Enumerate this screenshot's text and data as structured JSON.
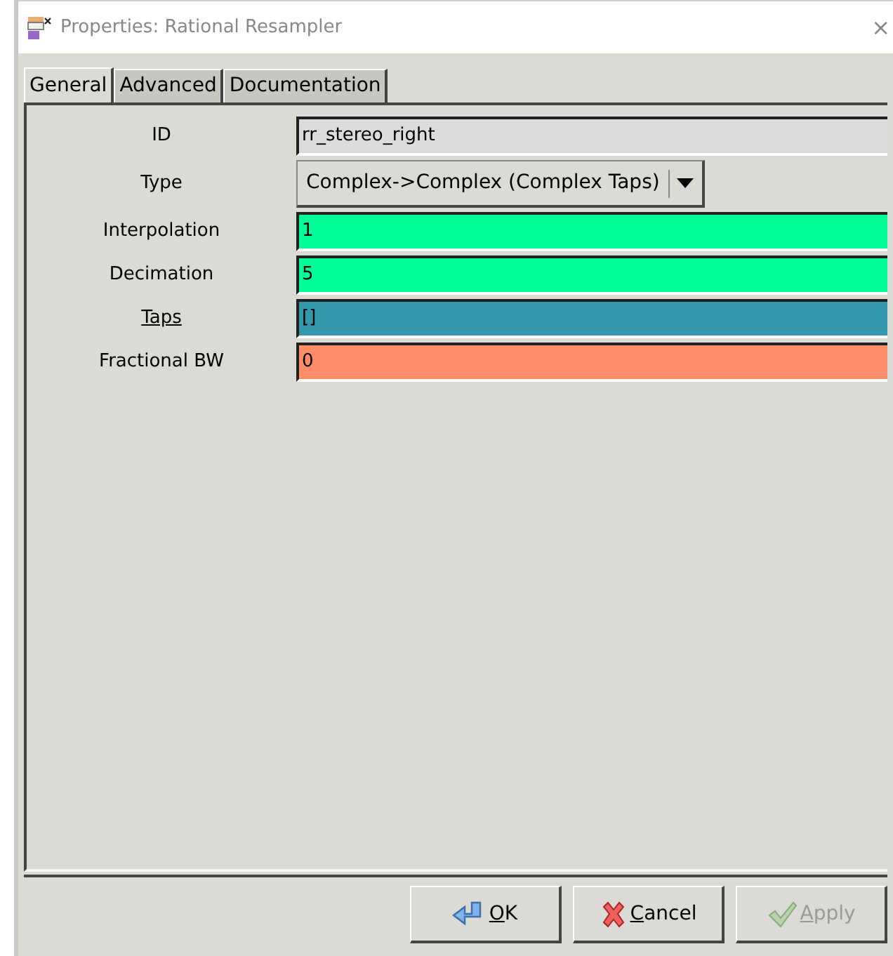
{
  "window": {
    "title": "Properties: Rational Resampler",
    "close": "×"
  },
  "tabs": [
    {
      "label": "General",
      "selected": true
    },
    {
      "label": "Advanced",
      "selected": false
    },
    {
      "label": "Documentation",
      "selected": false
    }
  ],
  "params": [
    {
      "label": "ID",
      "underlined": false,
      "kind": "text",
      "value": "rr_stereo_right",
      "color": "#dcdcdc"
    },
    {
      "label": "Type",
      "underlined": false,
      "kind": "dropdown",
      "value": "Complex->Complex (Complex Taps)"
    },
    {
      "label": "Interpolation",
      "underlined": false,
      "kind": "text",
      "value": "1",
      "color": "#00ff99"
    },
    {
      "label": "Decimation",
      "underlined": false,
      "kind": "text",
      "value": "5",
      "color": "#00ff99"
    },
    {
      "label": "Taps",
      "underlined": true,
      "kind": "text",
      "value": "[]",
      "color": "#3399aa"
    },
    {
      "label": "Fractional BW",
      "underlined": false,
      "kind": "text",
      "value": "0",
      "color": "#ff8c69"
    }
  ],
  "buttons": [
    {
      "kind": "ok",
      "mnemonic": "O",
      "rest": "K",
      "disabled": false
    },
    {
      "kind": "cancel",
      "mnemonic": "C",
      "rest": "ancel",
      "disabled": false
    },
    {
      "kind": "apply",
      "mnemonic": "A",
      "rest": "pply",
      "disabled": true
    }
  ]
}
